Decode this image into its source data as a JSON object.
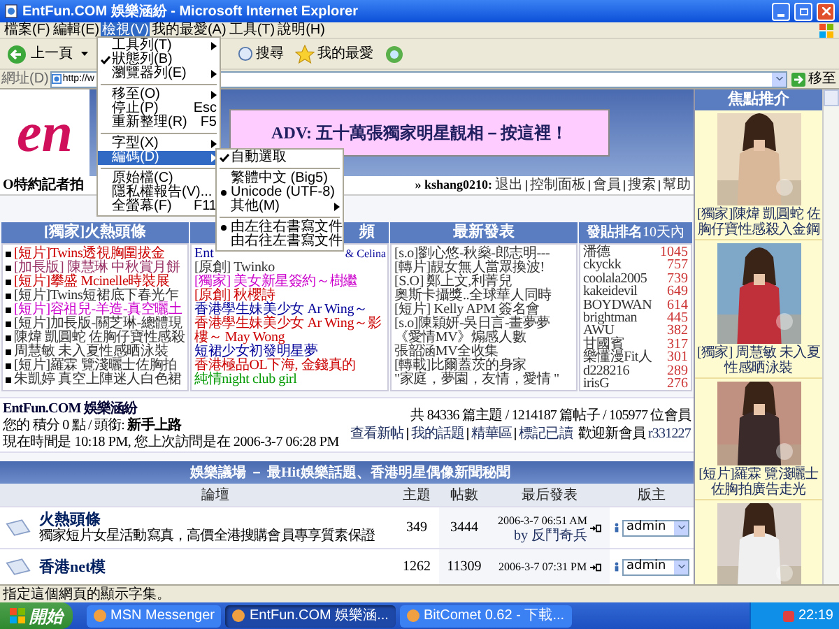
{
  "window": {
    "title": "EntFun.COM 娛樂涵紛 - Microsoft Internet Explorer"
  },
  "menu_bar": [
    {
      "label": "檔案(F)",
      "selected": false
    },
    {
      "label": "編輯(E)",
      "selected": false
    },
    {
      "label": "檢視(V)",
      "selected": true
    },
    {
      "label": "我的最愛(A)",
      "selected": false
    },
    {
      "label": "工具(T)",
      "selected": false
    },
    {
      "label": "說明(H)",
      "selected": false
    }
  ],
  "toolbar": {
    "back": "上一頁",
    "search": "搜尋",
    "favorites": "我的最愛"
  },
  "address_bar": {
    "label": "網址(D)",
    "value": "http://w",
    "go": "移至"
  },
  "view_menu": [
    {
      "kind": "item",
      "label": "工具列(T)",
      "submenu": true,
      "selected": false
    },
    {
      "kind": "check",
      "label": "狀態列(B)",
      "checked": true,
      "selected": false
    },
    {
      "kind": "item",
      "label": "瀏覽器列(E)",
      "submenu": true,
      "selected": false
    },
    {
      "kind": "separator"
    },
    {
      "kind": "item",
      "label": "移至(O)",
      "submenu": true,
      "selected": false
    },
    {
      "kind": "item",
      "label": "停止(P)",
      "shortcut": "Esc",
      "selected": false
    },
    {
      "kind": "item",
      "label": "重新整理(R)",
      "shortcut": "F5",
      "selected": false
    },
    {
      "kind": "separator"
    },
    {
      "kind": "item",
      "label": "字型(X)",
      "submenu": true,
      "selected": false
    },
    {
      "kind": "item",
      "label": "編碼(D)",
      "submenu": true,
      "selected": true
    },
    {
      "kind": "separator"
    },
    {
      "kind": "item",
      "label": "原始檔(C)",
      "selected": false
    },
    {
      "kind": "item",
      "label": "隱私權報告(V)...",
      "selected": false
    },
    {
      "kind": "item",
      "label": "全螢幕(F)",
      "shortcut": "F11",
      "selected": false
    }
  ],
  "encoding_menu": [
    {
      "kind": "check",
      "label": "自動選取",
      "checked": true,
      "selected": false
    },
    {
      "kind": "separator"
    },
    {
      "kind": "radio",
      "label": "繁體中文 (Big5)",
      "checked": false,
      "selected": false
    },
    {
      "kind": "radio",
      "label": "Unicode (UTF-8)",
      "checked": true,
      "selected": false
    },
    {
      "kind": "item",
      "label": "其他(M)",
      "submenu": true,
      "selected": false
    },
    {
      "kind": "separator"
    },
    {
      "kind": "radio",
      "label": "由左往右書寫文件",
      "checked": true,
      "selected": false
    },
    {
      "kind": "radio",
      "label": "由右往左書寫文件",
      "checked": false,
      "selected": false
    }
  ],
  "header": {
    "logo_text": "en",
    "banner": "ADV: 五十萬張獨家明星靚相－按這裡！"
  },
  "headline_fragment": "O特約記者拍",
  "user_bar": {
    "user": "» kshang0210:",
    "links": [
      "退出",
      "控制面板",
      "會員",
      "搜索",
      "幫助"
    ]
  },
  "columns": [
    {
      "heading": "[獨家]火熱頭條",
      "bullets": true,
      "items": [
        {
          "text": "[短片]Twins透視胸圍拔金",
          "color": "#cc0000"
        },
        {
          "text": "[加長版] 陳慧琳 中秋賞月餅",
          "color": "#993366"
        },
        {
          "text": "[短片]攀盛 Mcinelle時裝展",
          "color": "#cc0000"
        },
        {
          "text": "[短片]Twins短裙底下春光乍",
          "color": "#333333"
        },
        {
          "text": "[短片]容祖兒-羊造-真空曬土",
          "color": "#cc00cc"
        },
        {
          "text": "[短片]加長版-關芝琳-總體現",
          "color": "#333333"
        },
        {
          "text": "陳煒 凱圓蛇 佐胸仔寶性感殺",
          "color": "#333333"
        },
        {
          "text": "周慧敏 未入夏性感晒泳裝",
          "color": "#333333"
        },
        {
          "text": "[短片]羅霖 覽淺曬士佐胸拍",
          "color": "#333333"
        },
        {
          "text": "朱凱婷 真空上陣迷人白色裙",
          "color": "#333333"
        }
      ]
    },
    {
      "heading": "頻",
      "bullets": false,
      "items": [
        {
          "text": "Ent",
          "text_right": "& Celina",
          "color": "#000099"
        },
        {
          "text": "[原創] Twinko",
          "color": "#333333"
        },
        {
          "text": "[獨家] 美女新星簽約～樹繼",
          "color": "#cc00cc"
        },
        {
          "text": "[原創] 秋櫻詩",
          "color": "#cc0000"
        },
        {
          "text": "香港學生妹美少女 Ar Wing～",
          "color": "#000099"
        },
        {
          "text": "香港學生妹美少女 Ar Wing～影樓～ May Wong",
          "color": "#cc0000"
        },
        {
          "text": "短裙少女初發明星夢",
          "color": "#000099"
        },
        {
          "text": "香港極品OL下海, 金錢真的",
          "color": "#cc0000"
        },
        {
          "text": "純情night club girl",
          "color": "#009900"
        }
      ]
    },
    {
      "heading": "最新發表",
      "bullets": false,
      "items": [
        {
          "text": "[s.o]劉心悠-秋燊-郎志明---",
          "color": "#333333"
        },
        {
          "text": "[轉片]靚女無人當眾換波!",
          "color": "#333333"
        },
        {
          "text": "[S.O] 鄭上文,利菁兒",
          "color": "#333333"
        },
        {
          "text": "奧斯卡攝獎..全球華人同時",
          "color": "#333333"
        },
        {
          "text": "[短片] Kelly APM 簽名會",
          "color": "#333333"
        },
        {
          "text": "[s.o]陳穎妍-吳日言-畫夢夢",
          "color": "#333333"
        },
        {
          "text": "《愛情MV》煽感人數",
          "color": "#333333"
        },
        {
          "text": "張韶涵MV全收集",
          "color": "#333333"
        },
        {
          "text": "[轉載]比爾蓋茨的身家",
          "color": "#333333"
        },
        {
          "text": "\"家庭，夢園，友情，愛情 \"",
          "color": "#333333"
        }
      ]
    }
  ],
  "ranking": {
    "heading": "發貼排名",
    "heading_suffix": "10天內",
    "rows": [
      {
        "name": "潘德",
        "count": "1045"
      },
      {
        "name": "ckyckk",
        "count": "757"
      },
      {
        "name": "coolala2005",
        "count": "739"
      },
      {
        "name": "kakeidevil",
        "count": "649"
      },
      {
        "name": "BOYDWAN",
        "count": "614"
      },
      {
        "name": "brightman",
        "count": "445"
      },
      {
        "name": "AWU",
        "count": "382"
      },
      {
        "name": "甘國賓",
        "count": "317"
      },
      {
        "name": "樂懂漫Fit人",
        "count": "301"
      },
      {
        "name": "d228216",
        "count": "289"
      },
      {
        "name": "irisG",
        "count": "276"
      }
    ]
  },
  "stats": {
    "site": "EntFun.COM 娛樂涵紛",
    "points": "您的 積分 0 點 / 頭銜:",
    "rank": "新手上路",
    "time": "現在時間是 10:18 PM, 您上次訪問是在 2006-3-7 06:28 PM",
    "totals": "共 84336 篇主題 / 1214187 篇帖子 / 105977 位會員",
    "links": [
      "查看新帖",
      "我的話題",
      "精華區",
      "標記已讀"
    ],
    "welcome": "歡迎新會員",
    "new_member": "r331227"
  },
  "forum": {
    "title": "娛樂議場 － 最Hit娛樂話題、香港明星偶像新聞秘聞",
    "columns": [
      "論壇",
      "主題",
      "帖數",
      "最后發表",
      "版主"
    ],
    "rows": [
      {
        "name": "火熱頭條",
        "description": "獨家短片女星活動寫真，高價全港搜購會員專享質素保證",
        "topics": "349",
        "posts": "3444",
        "last_post": "2006-3-7 06:51 AM",
        "last_by": "by 反鬥奇兵",
        "moderator": "admin"
      },
      {
        "name": "香港net模",
        "topics": "1262",
        "posts": "11309",
        "last_post": "2006-3-7 07:31 PM",
        "moderator": "admin"
      }
    ]
  },
  "sidebar": {
    "title": "焦點推介",
    "items": [
      {
        "kind": "picture",
        "caption": "[獨家]陳煒 凱圓蛇 佐胸仔寶性感殺入金鋼"
      },
      {
        "kind": "picture",
        "caption": "[獨家] 周慧敏 未入夏性感晒泳裝"
      },
      {
        "kind": "picture",
        "caption": "[短片]羅霖 覽淺曬士佐胸拍廣告走光"
      },
      {
        "kind": "picture"
      }
    ]
  },
  "status_bar": {
    "text": "指定這個網頁的顯示字集。"
  },
  "taskbar": {
    "start": "開始",
    "tasks": [
      {
        "label": "MSN Messenger",
        "selected": false
      },
      {
        "label": "EntFun.COM 娛樂涵...",
        "selected": true
      },
      {
        "label": "BitComet 0.62 - 下載...",
        "selected": false
      }
    ],
    "clock": "22:19"
  }
}
